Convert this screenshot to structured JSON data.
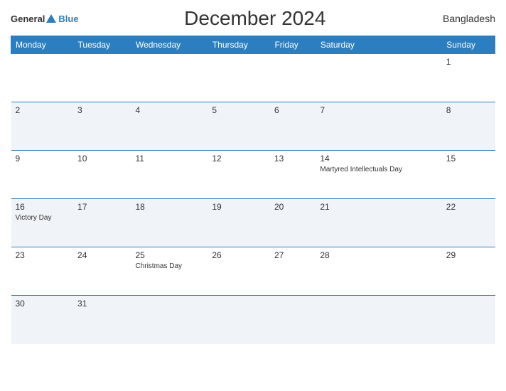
{
  "header": {
    "logo_general": "General",
    "logo_blue": "Blue",
    "title": "December 2024",
    "country": "Bangladesh"
  },
  "weekdays": [
    "Monday",
    "Tuesday",
    "Wednesday",
    "Thursday",
    "Friday",
    "Saturday",
    "Sunday"
  ],
  "rows": [
    [
      {
        "day": "",
        "event": ""
      },
      {
        "day": "",
        "event": ""
      },
      {
        "day": "",
        "event": ""
      },
      {
        "day": "",
        "event": ""
      },
      {
        "day": "",
        "event": ""
      },
      {
        "day": "",
        "event": ""
      },
      {
        "day": "1",
        "event": ""
      }
    ],
    [
      {
        "day": "2",
        "event": ""
      },
      {
        "day": "3",
        "event": ""
      },
      {
        "day": "4",
        "event": ""
      },
      {
        "day": "5",
        "event": ""
      },
      {
        "day": "6",
        "event": ""
      },
      {
        "day": "7",
        "event": ""
      },
      {
        "day": "8",
        "event": ""
      }
    ],
    [
      {
        "day": "9",
        "event": ""
      },
      {
        "day": "10",
        "event": ""
      },
      {
        "day": "11",
        "event": ""
      },
      {
        "day": "12",
        "event": ""
      },
      {
        "day": "13",
        "event": ""
      },
      {
        "day": "14",
        "event": "Martyred Intellectuals Day"
      },
      {
        "day": "15",
        "event": ""
      }
    ],
    [
      {
        "day": "16",
        "event": "Victory Day"
      },
      {
        "day": "17",
        "event": ""
      },
      {
        "day": "18",
        "event": ""
      },
      {
        "day": "19",
        "event": ""
      },
      {
        "day": "20",
        "event": ""
      },
      {
        "day": "21",
        "event": ""
      },
      {
        "day": "22",
        "event": ""
      }
    ],
    [
      {
        "day": "23",
        "event": ""
      },
      {
        "day": "24",
        "event": ""
      },
      {
        "day": "25",
        "event": "Christmas Day"
      },
      {
        "day": "26",
        "event": ""
      },
      {
        "day": "27",
        "event": ""
      },
      {
        "day": "28",
        "event": ""
      },
      {
        "day": "29",
        "event": ""
      }
    ],
    [
      {
        "day": "30",
        "event": ""
      },
      {
        "day": "31",
        "event": ""
      },
      {
        "day": "",
        "event": ""
      },
      {
        "day": "",
        "event": ""
      },
      {
        "day": "",
        "event": ""
      },
      {
        "day": "",
        "event": ""
      },
      {
        "day": "",
        "event": ""
      }
    ]
  ]
}
